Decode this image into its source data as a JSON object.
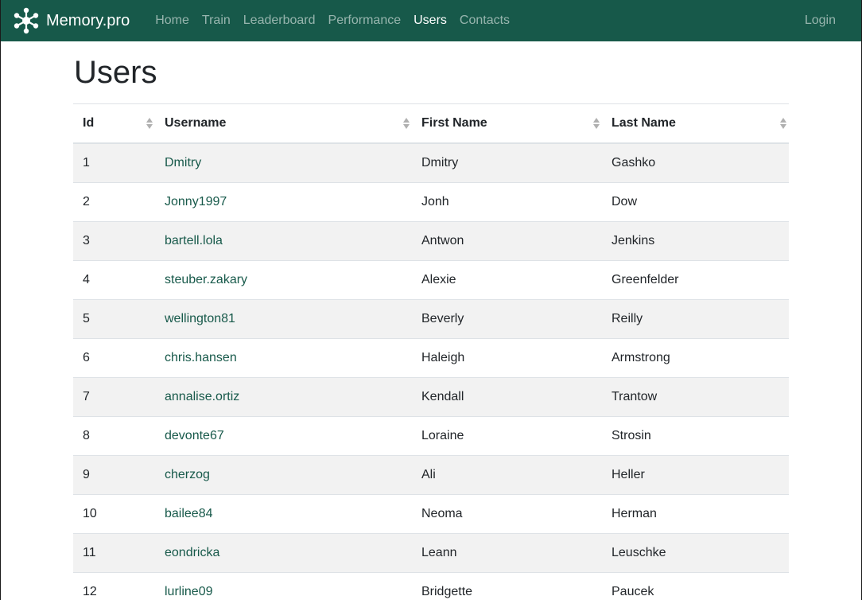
{
  "brand": {
    "name": "Memory.pro"
  },
  "nav": {
    "items": [
      {
        "label": "Home",
        "active": false
      },
      {
        "label": "Train",
        "active": false
      },
      {
        "label": "Leaderboard",
        "active": false
      },
      {
        "label": "Performance",
        "active": false
      },
      {
        "label": "Users",
        "active": true
      },
      {
        "label": "Contacts",
        "active": false
      }
    ],
    "login_label": "Login"
  },
  "page": {
    "title": "Users"
  },
  "table": {
    "headers": [
      "Id",
      "Username",
      "First Name",
      "Last Name"
    ],
    "rows": [
      {
        "id": "1",
        "username": "Dmitry",
        "first_name": "Dmitry",
        "last_name": "Gashko"
      },
      {
        "id": "2",
        "username": "Jonny1997",
        "first_name": "Jonh",
        "last_name": "Dow"
      },
      {
        "id": "3",
        "username": "bartell.lola",
        "first_name": "Antwon",
        "last_name": "Jenkins"
      },
      {
        "id": "4",
        "username": "steuber.zakary",
        "first_name": "Alexie",
        "last_name": "Greenfelder"
      },
      {
        "id": "5",
        "username": "wellington81",
        "first_name": "Beverly",
        "last_name": "Reilly"
      },
      {
        "id": "6",
        "username": "chris.hansen",
        "first_name": "Haleigh",
        "last_name": "Armstrong"
      },
      {
        "id": "7",
        "username": "annalise.ortiz",
        "first_name": "Kendall",
        "last_name": "Trantow"
      },
      {
        "id": "8",
        "username": "devonte67",
        "first_name": "Loraine",
        "last_name": "Strosin"
      },
      {
        "id": "9",
        "username": "cherzog",
        "first_name": "Ali",
        "last_name": "Heller"
      },
      {
        "id": "10",
        "username": "bailee84",
        "first_name": "Neoma",
        "last_name": "Herman"
      },
      {
        "id": "11",
        "username": "eondricka",
        "first_name": "Leann",
        "last_name": "Leuschke"
      },
      {
        "id": "12",
        "username": "lurline09",
        "first_name": "Bridgette",
        "last_name": "Paucek"
      }
    ]
  },
  "colors": {
    "navbar_bg": "#17594a",
    "link": "#17594a",
    "stripe": "#f2f2f2"
  },
  "icons": {
    "brand": "network-nodes-icon",
    "sort": "sort-arrows-icon"
  }
}
